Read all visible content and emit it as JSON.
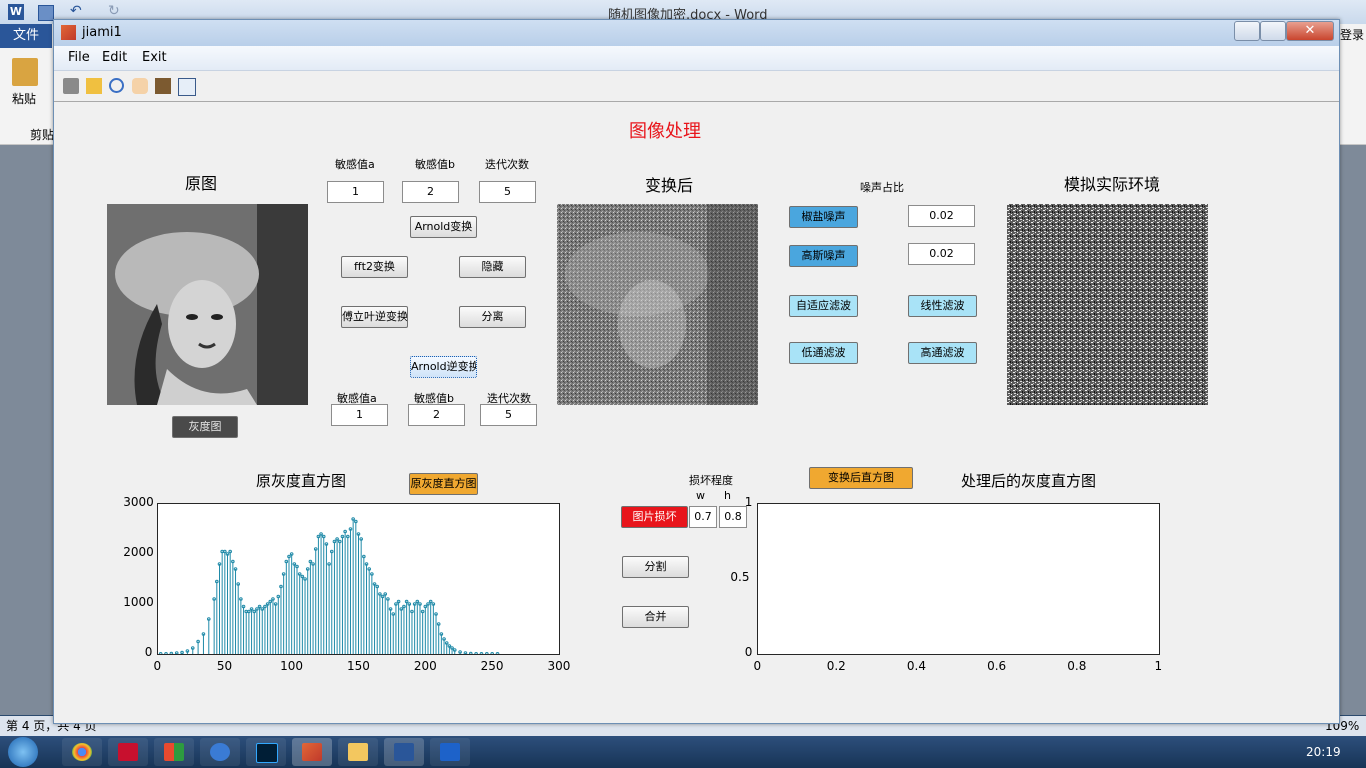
{
  "word": {
    "title": "随机图像加密.docx - Word",
    "file_tab": "文件",
    "paste_label": "粘贴",
    "clipboard_label": "剪贴",
    "login": "登录",
    "status_left": "第 4 页，共 4 页",
    "zoom": "109%"
  },
  "figure": {
    "title": "jiami1",
    "menus": [
      "File",
      "Edit",
      "Exit"
    ]
  },
  "ui": {
    "main_title": "图像处理",
    "original_title": "原图",
    "transformed_title": "变换后",
    "sim_env_title": "模拟实际环境",
    "param_a_label": "敏感值a",
    "param_b_label": "敏感值b",
    "iter_label": "迭代次数",
    "param_a_value": "1",
    "param_b_value": "2",
    "iter_value": "5",
    "arnold_btn": "Arnold变换",
    "fft2_btn": "fft2变换",
    "hide_btn": "隐藏",
    "ifft_btn": "傅立叶逆变换",
    "separate_btn": "分离",
    "arnold_inv_btn": "Arnold逆变换",
    "inv_param_a_label": "敏感值a",
    "inv_param_b_label": "敏感值b",
    "inv_iter_label": "迭代次数",
    "inv_param_a_value": "1",
    "inv_param_b_value": "2",
    "inv_iter_value": "5",
    "gray_btn": "灰度图",
    "noise_ratio_label": "噪声占比",
    "salt_btn": "椒盐噪声",
    "salt_value": "0.02",
    "gauss_btn": "高斯噪声",
    "gauss_value": "0.02",
    "adaptive_btn": "自适应滤波",
    "linear_btn": "线性滤波",
    "lowpass_btn": "低通滤波",
    "highpass_btn": "高通滤波",
    "orig_hist_title": "原灰度直方图",
    "orig_hist_btn": "原灰度直方图",
    "damage_label": "损坏程度",
    "w_label": "w",
    "h_label": "h",
    "damage_btn": "图片损坏",
    "w_value": "0.7",
    "h_value": "0.8",
    "split_btn": "分割",
    "merge_btn": "合并",
    "trans_hist_btn": "变换后直方图",
    "proc_hist_title": "处理后的灰度直方图",
    "accent_red": "#e8151b",
    "noise_btn_color": "#4aa6de",
    "filter_btn_color": "#a9e3f7",
    "hist_btn_color": "#f0a830",
    "stem_color": "#1f8aa8"
  },
  "chart_data": [
    {
      "type": "bar",
      "title": "原灰度直方图",
      "xlabel": "",
      "ylabel": "",
      "xlim": [
        0,
        300
      ],
      "ylim": [
        0,
        3000
      ],
      "xticks": [
        "0",
        "50",
        "100",
        "150",
        "200",
        "250",
        "300"
      ],
      "yticks": [
        "0",
        "1000",
        "2000",
        "3000"
      ],
      "x": [
        2,
        6,
        10,
        14,
        18,
        22,
        26,
        30,
        34,
        38,
        42,
        44,
        46,
        48,
        50,
        52,
        54,
        56,
        58,
        60,
        62,
        64,
        66,
        68,
        70,
        72,
        74,
        76,
        78,
        80,
        82,
        84,
        86,
        88,
        90,
        92,
        94,
        96,
        98,
        100,
        102,
        104,
        106,
        108,
        110,
        112,
        114,
        116,
        118,
        120,
        122,
        124,
        126,
        128,
        130,
        132,
        134,
        136,
        138,
        140,
        142,
        144,
        146,
        148,
        150,
        152,
        154,
        156,
        158,
        160,
        162,
        164,
        166,
        168,
        170,
        172,
        174,
        176,
        178,
        180,
        182,
        184,
        186,
        188,
        190,
        192,
        194,
        196,
        198,
        200,
        202,
        204,
        206,
        208,
        210,
        212,
        214,
        216,
        218,
        220,
        222,
        226,
        230,
        234,
        238,
        242,
        246,
        250,
        254
      ],
      "values": [
        5,
        5,
        10,
        20,
        30,
        60,
        120,
        250,
        400,
        700,
        1100,
        1450,
        1800,
        2050,
        2050,
        2000,
        2050,
        1850,
        1700,
        1400,
        1100,
        950,
        850,
        850,
        900,
        850,
        900,
        950,
        900,
        950,
        1000,
        1050,
        1100,
        1000,
        1150,
        1350,
        1600,
        1850,
        1950,
        2000,
        1800,
        1750,
        1600,
        1550,
        1500,
        1700,
        1850,
        1800,
        2100,
        2350,
        2400,
        2350,
        2200,
        1800,
        2050,
        2250,
        2300,
        2250,
        2350,
        2450,
        2350,
        2500,
        2700,
        2650,
        2400,
        2300,
        1950,
        1800,
        1700,
        1600,
        1400,
        1350,
        1200,
        1150,
        1200,
        1100,
        900,
        800,
        1000,
        1050,
        900,
        950,
        1050,
        1000,
        850,
        1000,
        1050,
        1000,
        850,
        950,
        1000,
        1050,
        1000,
        800,
        600,
        400,
        300,
        220,
        160,
        120,
        80,
        40,
        20,
        10,
        5,
        5,
        5,
        5,
        5
      ]
    },
    {
      "type": "line",
      "title": "处理后的灰度直方图",
      "xlabel": "",
      "ylabel": "",
      "xlim": [
        0,
        1
      ],
      "ylim": [
        0,
        1
      ],
      "xticks": [
        "0",
        "0.2",
        "0.4",
        "0.6",
        "0.8",
        "1"
      ],
      "yticks": [
        "0",
        "0.5",
        "1"
      ],
      "series": []
    }
  ]
}
